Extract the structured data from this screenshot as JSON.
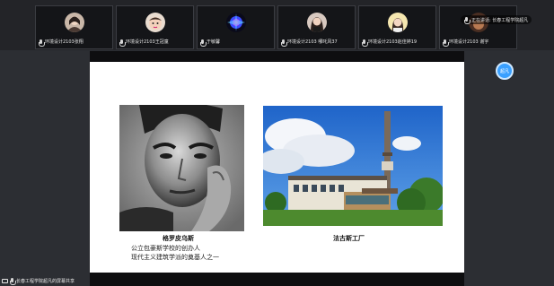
{
  "participants": [
    {
      "name": "环境设计2103张翔",
      "avatar": "avatar-girl-dark"
    },
    {
      "name": "环境设计2103王冠童",
      "avatar": "avatar-baby"
    },
    {
      "name": "于敏馨",
      "avatar": "avatar-blue-burst"
    },
    {
      "name": "环境设计2103 哪吒风37",
      "avatar": "avatar-woman"
    },
    {
      "name": "环境设计2103赵佳婷19",
      "avatar": "avatar-woman-yellow"
    },
    {
      "name": "环境设计2103 谢宇",
      "avatar": "avatar-dark"
    }
  ],
  "speaking": {
    "label": "正在讲话: 长春工程学院超凡"
  },
  "slide": {
    "left_caption": "格罗皮乌斯",
    "right_caption": "法古斯工厂",
    "desc_line1": "公立包豪斯学校的创办人",
    "desc_line2": "现代主义建筑学派的奠基人之一"
  },
  "self_avatar": {
    "label": "超凡"
  },
  "footer": {
    "label": "长春工程学院超凡的屏幕共享"
  },
  "colors": {
    "accent": "#3aa0ff",
    "strip": "#232428",
    "background": "#2c2e33"
  }
}
